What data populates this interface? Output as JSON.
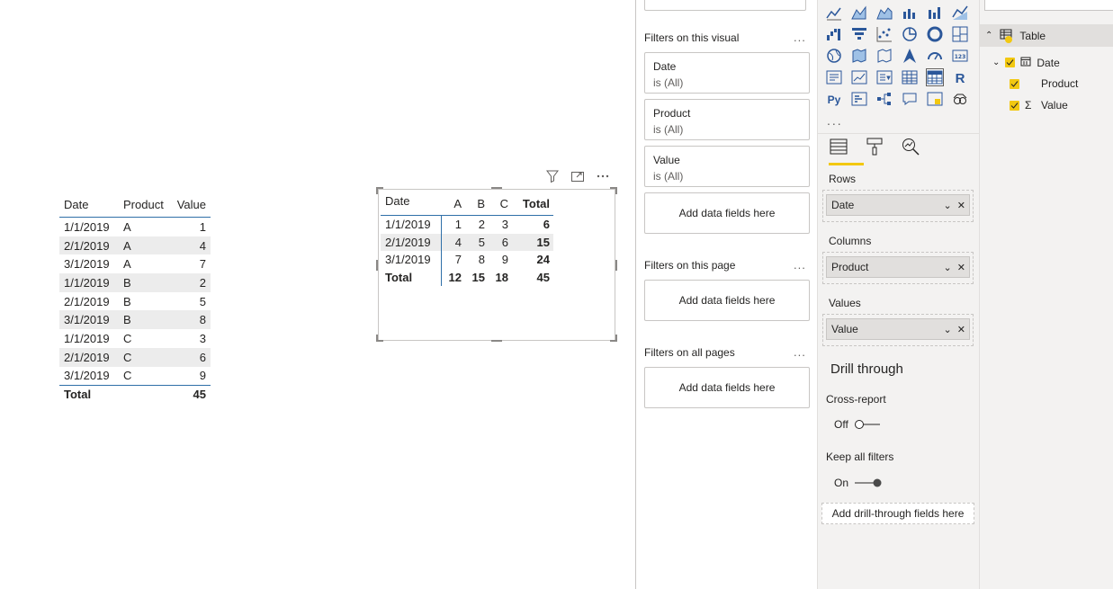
{
  "table_visual": {
    "headers": [
      "Date",
      "Product",
      "Value"
    ],
    "rows": [
      [
        "1/1/2019",
        "A",
        "1"
      ],
      [
        "2/1/2019",
        "A",
        "4"
      ],
      [
        "3/1/2019",
        "A",
        "7"
      ],
      [
        "1/1/2019",
        "B",
        "2"
      ],
      [
        "2/1/2019",
        "B",
        "5"
      ],
      [
        "3/1/2019",
        "B",
        "8"
      ],
      [
        "1/1/2019",
        "C",
        "3"
      ],
      [
        "2/1/2019",
        "C",
        "6"
      ],
      [
        "3/1/2019",
        "C",
        "9"
      ]
    ],
    "total_label": "Total",
    "total_value": "45"
  },
  "matrix_visual": {
    "headers": [
      "Date",
      "A",
      "B",
      "C",
      "Total"
    ],
    "rows": [
      [
        "1/1/2019",
        "1",
        "2",
        "3",
        "6"
      ],
      [
        "2/1/2019",
        "4",
        "5",
        "6",
        "15"
      ],
      [
        "3/1/2019",
        "7",
        "8",
        "9",
        "24"
      ]
    ],
    "total_row": [
      "Total",
      "12",
      "15",
      "18",
      "45"
    ],
    "header_icons": [
      "filter-icon",
      "focus-mode-icon",
      "more-options-icon"
    ]
  },
  "filters_pane": {
    "visual_section": "Filters on this visual",
    "visual_filters": [
      {
        "field": "Date",
        "state": "is (All)"
      },
      {
        "field": "Product",
        "state": "is (All)"
      },
      {
        "field": "Value",
        "state": "is (All)"
      }
    ],
    "add_label": "Add data fields here",
    "page_section": "Filters on this page",
    "all_pages_section": "Filters on all pages",
    "more": "..."
  },
  "viz_pane": {
    "more": "...",
    "wells": {
      "rows_label": "Rows",
      "rows_field": "Date",
      "columns_label": "Columns",
      "columns_field": "Product",
      "values_label": "Values",
      "values_field": "Value"
    },
    "drill_title": "Drill through",
    "cross_report_label": "Cross-report",
    "cross_report_state": "Off",
    "keep_filters_label": "Keep all filters",
    "keep_filters_state": "On",
    "drill_add": "Add drill-through fields here",
    "accent_color": "#f2c811"
  },
  "fields_pane": {
    "table_name": "Table",
    "fields": [
      "Date",
      "Product",
      "Value"
    ]
  }
}
